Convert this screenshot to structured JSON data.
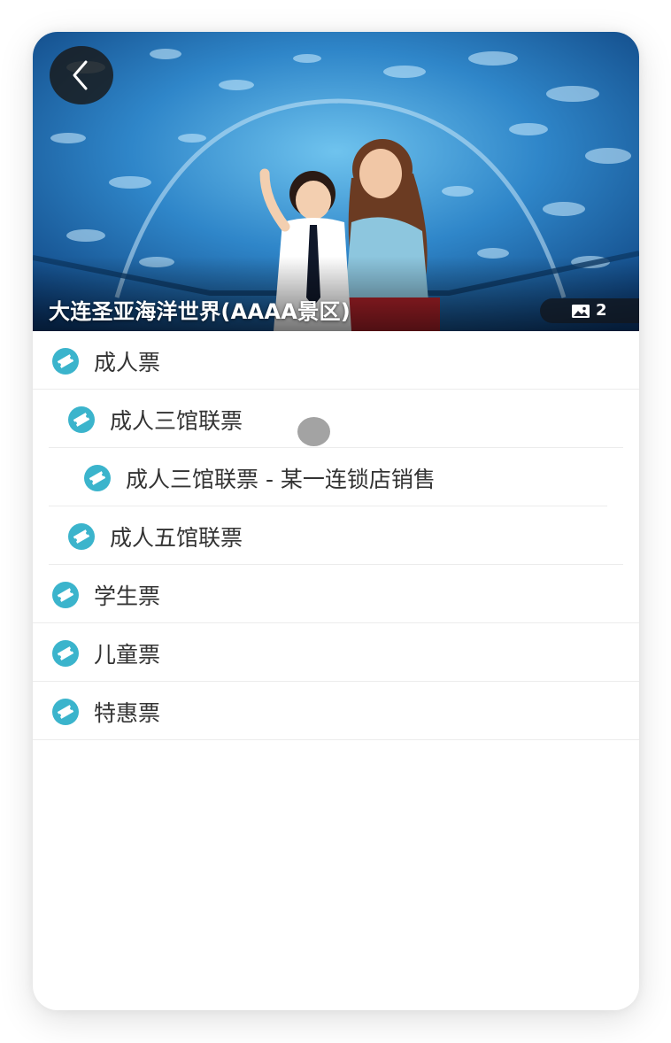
{
  "hero": {
    "title": "大连圣亚海洋世界(AAAA景区)",
    "photo_count": "2"
  },
  "colors": {
    "accent": "#3bb4cc",
    "text": "#333333",
    "divider": "#ececec"
  },
  "ticket_categories": [
    {
      "label": "成人票",
      "level": 0
    },
    {
      "label": "成人三馆联票",
      "level": 1
    },
    {
      "label": "成人三馆联票 - 某一连锁店销售",
      "level": 2
    },
    {
      "label": "成人五馆联票",
      "level": 1
    },
    {
      "label": "学生票",
      "level": 0
    },
    {
      "label": "儿童票",
      "level": 0
    },
    {
      "label": "特惠票",
      "level": 0
    }
  ]
}
